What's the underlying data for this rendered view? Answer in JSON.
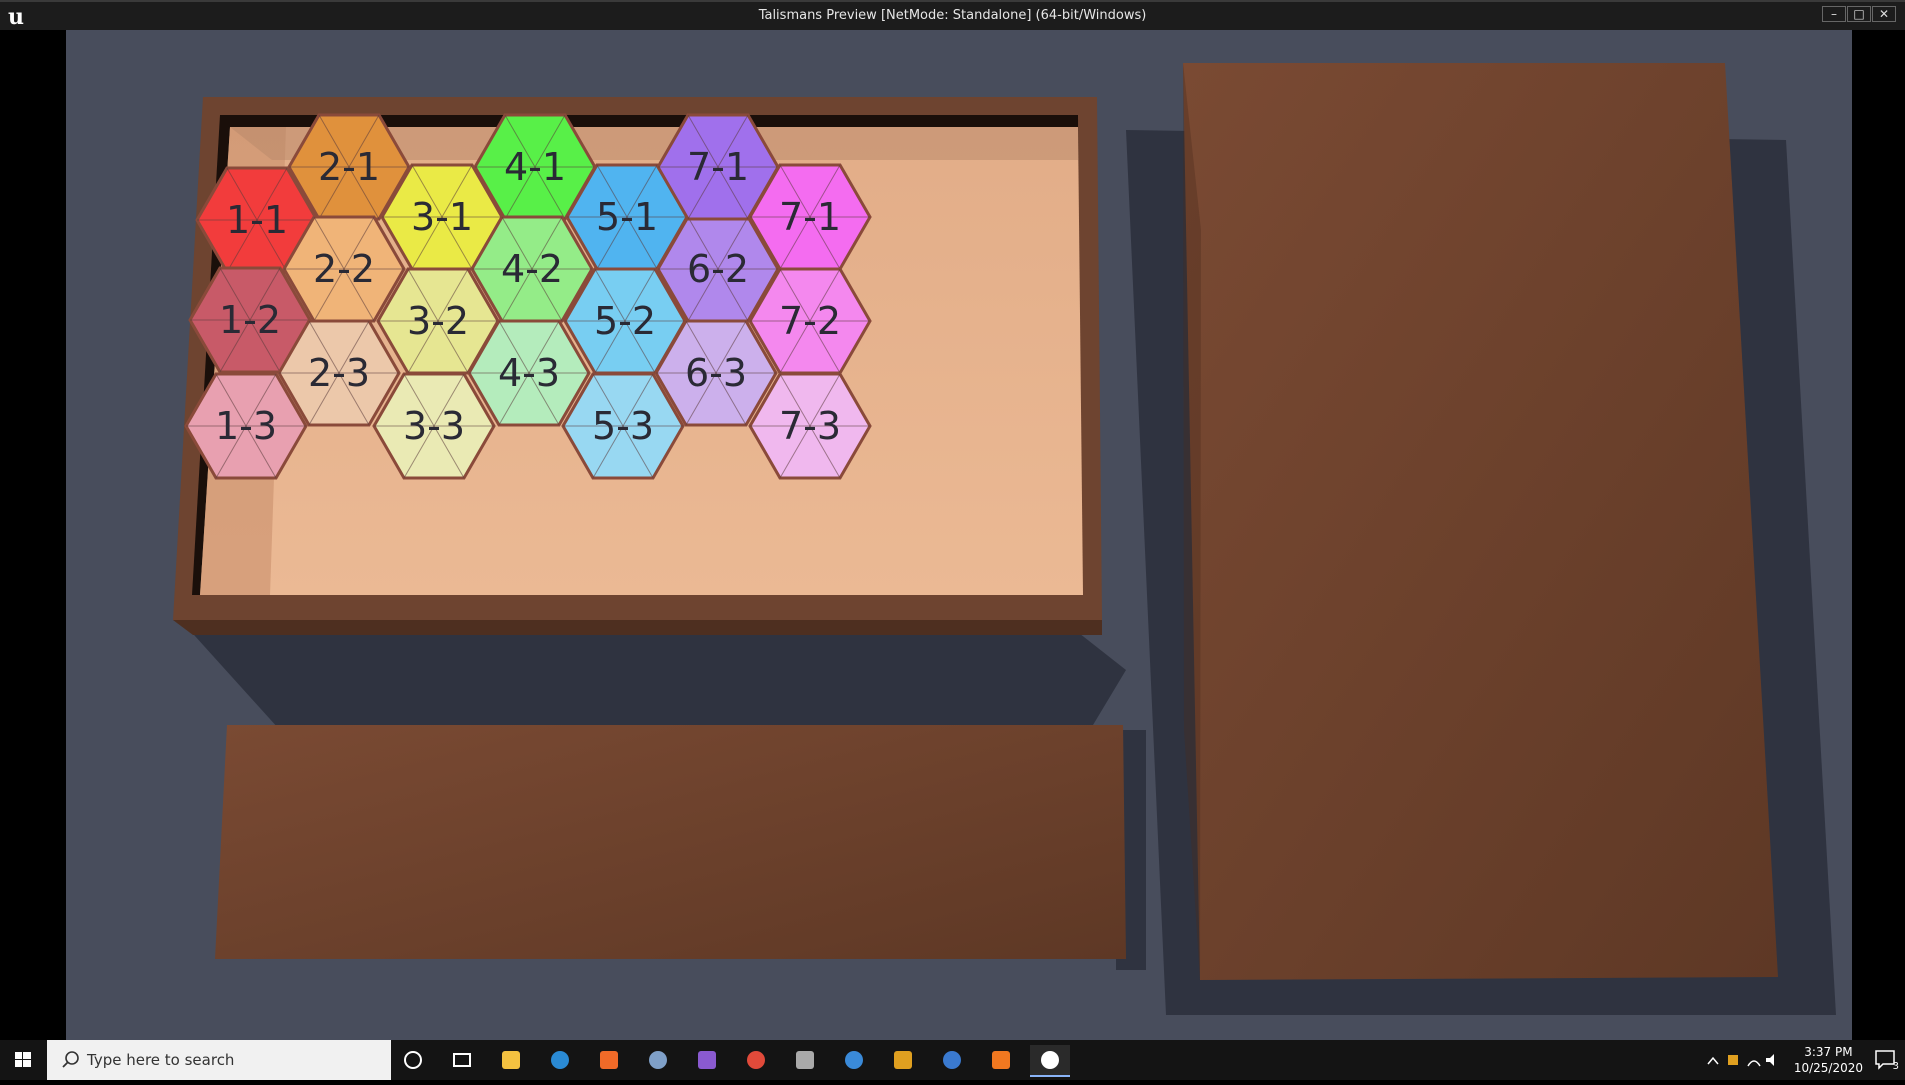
{
  "window": {
    "title": "Talismans Preview [NetMode: Standalone] (64-bit/Windows)",
    "logo_glyph": "u",
    "minimize_glyph": "–",
    "maximize_glyph": "□",
    "close_glyph": "✕"
  },
  "scene": {
    "background_color": "#484d5c",
    "board_color": "#6e4430",
    "tray_floor_color": "#e8b48e"
  },
  "tiles": [
    {
      "label": "1-1",
      "color": "#f23c3c"
    },
    {
      "label": "1-2",
      "color": "#c85a68"
    },
    {
      "label": "1-3",
      "color": "#e8a0b0"
    },
    {
      "label": "2-1",
      "color": "#e0913c"
    },
    {
      "label": "2-2",
      "color": "#f0b478"
    },
    {
      "label": "2-3",
      "color": "#ecc8aa"
    },
    {
      "label": "3-1",
      "color": "#eaea46"
    },
    {
      "label": "3-2",
      "color": "#e6e692"
    },
    {
      "label": "3-3",
      "color": "#eaeab4"
    },
    {
      "label": "4-1",
      "color": "#58f048"
    },
    {
      "label": "4-2",
      "color": "#94ec88"
    },
    {
      "label": "4-3",
      "color": "#b4ecbc"
    },
    {
      "label": "5-1",
      "color": "#50b4f0"
    },
    {
      "label": "5-2",
      "color": "#78cef2"
    },
    {
      "label": "5-3",
      "color": "#98d8f2"
    },
    {
      "label": "6-2",
      "color": "#b088ec"
    },
    {
      "label": "6-3",
      "color": "#ccb0ec"
    },
    {
      "label": "7-1",
      "color": "#a070ec"
    },
    {
      "label": "7-1",
      "color": "#f46cf0"
    },
    {
      "label": "7-2",
      "color": "#f488ee"
    },
    {
      "label": "7-3",
      "color": "#f0b8ee"
    }
  ],
  "taskbar": {
    "search_placeholder": "Type here to search",
    "icons": [
      "cortana-icon",
      "task-view-icon",
      "file-explorer-icon",
      "edge-icon",
      "firefox-icon",
      "calculator-icon",
      "visual-studio-icon",
      "chrome-icon",
      "terminal-icon",
      "steam-icon",
      "game-icon",
      "photos-icon",
      "blender-icon",
      "unreal-engine-icon"
    ],
    "time": "3:37 PM",
    "date": "10/25/2020",
    "notification_count": "3"
  }
}
